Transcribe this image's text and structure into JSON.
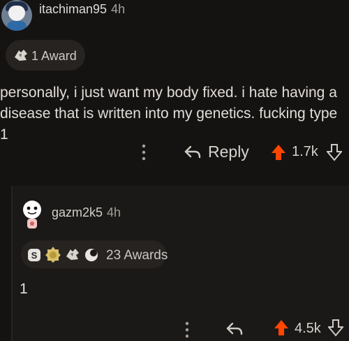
{
  "comment_top": {
    "username": "itachiman95",
    "time": "4h",
    "award_label": "1 Award",
    "body": "personally, i just want my body fixed. i hate having a disease that is written into my genetics. fucking type 1",
    "reply_label": "Reply",
    "score": "1.7k"
  },
  "comment_reply": {
    "username": "gazm2k5",
    "time": "4h",
    "awards_label": "23 Awards",
    "body": "1",
    "score": "4.5k"
  },
  "colors": {
    "upvote": "#ff4500",
    "background": "#151312",
    "reply_panel": "#1b1917"
  },
  "icons": [
    "avatar",
    "award-icon",
    "more-vertical-icon",
    "reply-arrow-icon",
    "upvote-arrow-icon",
    "downvote-arrow-icon",
    "silver-award-icon",
    "gold-award-icon",
    "helpful-award-icon",
    "wholesome-award-icon"
  ]
}
